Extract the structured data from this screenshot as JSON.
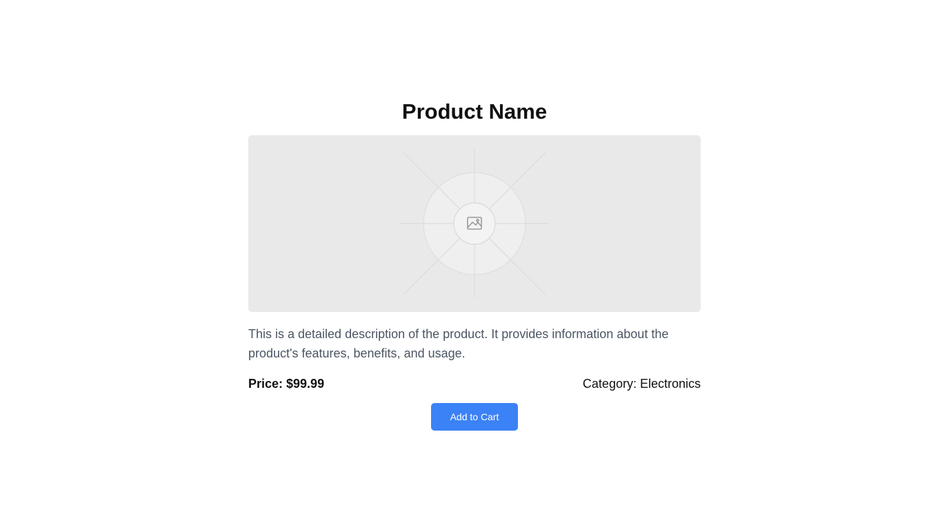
{
  "product": {
    "name": "Product Name",
    "description": "This is a detailed description of the product. It provides information about the product's features, benefits, and usage.",
    "price_text": "Price: $99.99",
    "category_text": "Category: Electronics",
    "image_placeholder_icon": "image-placeholder-icon"
  },
  "actions": {
    "add_to_cart_label": "Add to Cart"
  },
  "colors": {
    "accent": "#3b82f6",
    "placeholder_bg": "#e9e9e9",
    "description_text": "#4b5563"
  }
}
